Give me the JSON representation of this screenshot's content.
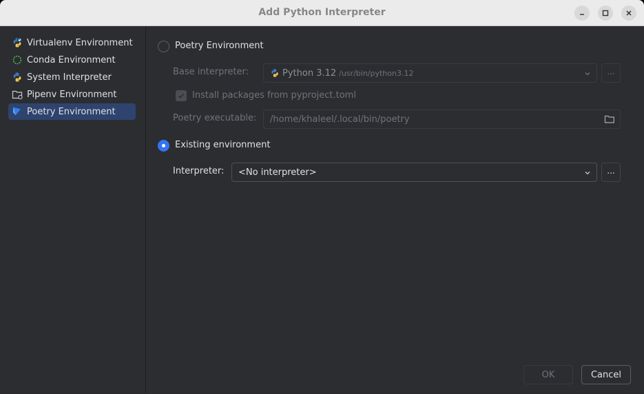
{
  "window": {
    "title": "Add Python Interpreter"
  },
  "titlebar_buttons": {
    "minimize": "minimize-icon",
    "maximize": "maximize-icon",
    "close": "close-icon"
  },
  "sidebar": {
    "items": [
      {
        "label": "Virtualenv Environment",
        "icon": "virtualenv-icon"
      },
      {
        "label": "Conda Environment",
        "icon": "conda-icon"
      },
      {
        "label": "System Interpreter",
        "icon": "python-icon"
      },
      {
        "label": "Pipenv Environment",
        "icon": "pipenv-icon"
      },
      {
        "label": "Poetry Environment",
        "icon": "poetry-icon",
        "selected": true
      }
    ]
  },
  "main": {
    "poetry_radio_label": "Poetry Environment",
    "base_interpreter": {
      "label": "Base interpreter:",
      "value": "Python 3.12",
      "path": "/usr/bin/python3.12",
      "browse": "..."
    },
    "install_packages": {
      "label": "Install packages from pyproject.toml",
      "checked": true
    },
    "poetry_executable": {
      "label": "Poetry executable:",
      "value": "/home/khaleel/.local/bin/poetry"
    },
    "existing_radio_label": "Existing environment",
    "interpreter": {
      "label": "Interpreter:",
      "value": "<No interpreter>",
      "browse": "..."
    }
  },
  "footer": {
    "ok_label": "OK",
    "cancel_label": "Cancel"
  },
  "colors": {
    "accent": "#3574f0",
    "selected_bg": "#2e436e",
    "window_bg": "#2b2d30"
  }
}
